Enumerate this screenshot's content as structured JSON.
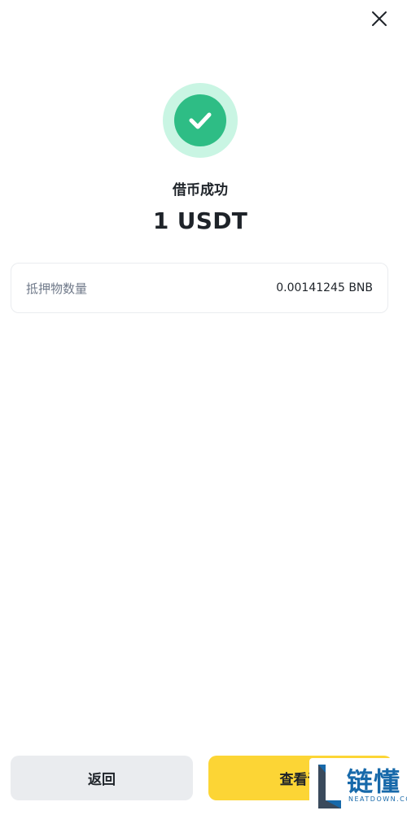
{
  "header": {
    "close_icon": "close-icon"
  },
  "result": {
    "icon": "check-circle-icon",
    "status": "借币成功",
    "amount": "1 USDT",
    "colors": {
      "success": "#2ebd85",
      "success_halo": "#c9f5e3"
    }
  },
  "details": {
    "rows": [
      {
        "label": "抵押物数量",
        "value": "0.00141245 BNB"
      }
    ]
  },
  "actions": {
    "back_label": "返回",
    "view_order_label": "查看订",
    "colors": {
      "primary": "#fcd535",
      "secondary": "#eaecef"
    }
  },
  "watermark": {
    "text": "链懂",
    "subtext": "NEATDOWN.COM"
  }
}
